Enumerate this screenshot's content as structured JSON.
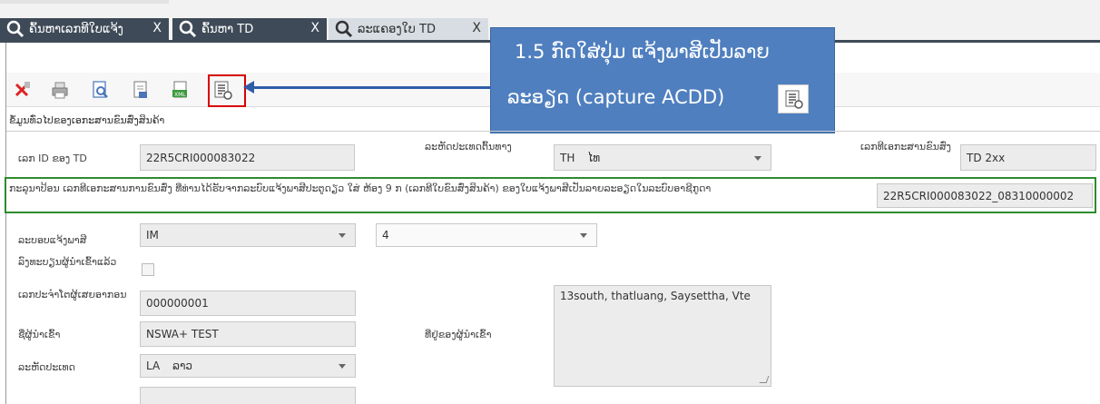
{
  "tabs": [
    {
      "label": "ຄົ້ນຫາເລກທີໃບແຈ້ງ",
      "close": "X"
    },
    {
      "label": "ຄົ້ນຫາ TD",
      "close": "X"
    },
    {
      "label": "ລະແຄອງໃບ TD",
      "close": "X"
    }
  ],
  "callout": {
    "line1": "1.5 ກົດໃສ່ປຸ່ມ ແຈ້ງພາສີເປັນລາຍ",
    "line2": "ລະອຽດ (capture ACDD)"
  },
  "section_title": "ຂໍ້ມູນທົ່ວໄປຂອງເອກະສານຂົນສົ່ງສິນຄ້າ",
  "form": {
    "td_id_label": "ເລກ ID ຂອງ TD",
    "td_id_value": "22R5CRI000083022",
    "origin_country_label": "ລະຫັດປະເທດຕົ້ນທາງ",
    "origin_country_code": "TH",
    "origin_country_name": "ໄທ",
    "transport_doc_label": "ເລກທີເອກະສານຂົນສົ່ງ",
    "transport_doc_value": "TD 2xx",
    "note": "ກະລຸນາປ້ອນ ເລກທີເອກະສານການຂົນສົ່ງ ທີ່ທ່ານໄດ້ຮັບຈາກລະບົບແຈ້ງພາສີປະຕູດຽວ ໃສ່ ຫ້ອງ 9 ກ (ເລກທີໃບຂົນສົ່ງສິນຄ້າ) ຂອງໃບແຈ້ງພາສີເປັນລາຍລະອຽດໃນລະບົບອາຊີກູດາ",
    "ref_number_value": "22R5CRI000083022_08310000002",
    "regime_label": "ລະບອບແຈ້ງພາສີ",
    "regime_value": "IM",
    "regime_sub_value": "4",
    "importer_registered_label": "ລົງທະບຽນຜູ້ນຳເຂົ້າແລ້ວ",
    "taxpayer_label": "ເລກປະຈຳໂຕຜູ້ເສຍອາກອນ",
    "taxpayer_value": "000000001",
    "importer_name_label": "ຊື່ຜູ້ນຳເຂົ້າ",
    "importer_name_value": "NSWA+ TEST",
    "importer_address_label": "ທີ່ຢູ່ຂອງຜູ້ນຳເຂົ້າ",
    "importer_address_value": "13south, thatluang, Saysettha, Vte",
    "country_label": "ລະຫັດປະເທດ",
    "country_code": "LA",
    "country_name": "ລາວ"
  },
  "colors": {
    "tab_dark": "#3e4a57",
    "callout_blue": "#4f7fbf",
    "arrow_blue": "#2e5ca8",
    "highlight_red": "#d80000",
    "note_green": "#2e8b2e"
  }
}
